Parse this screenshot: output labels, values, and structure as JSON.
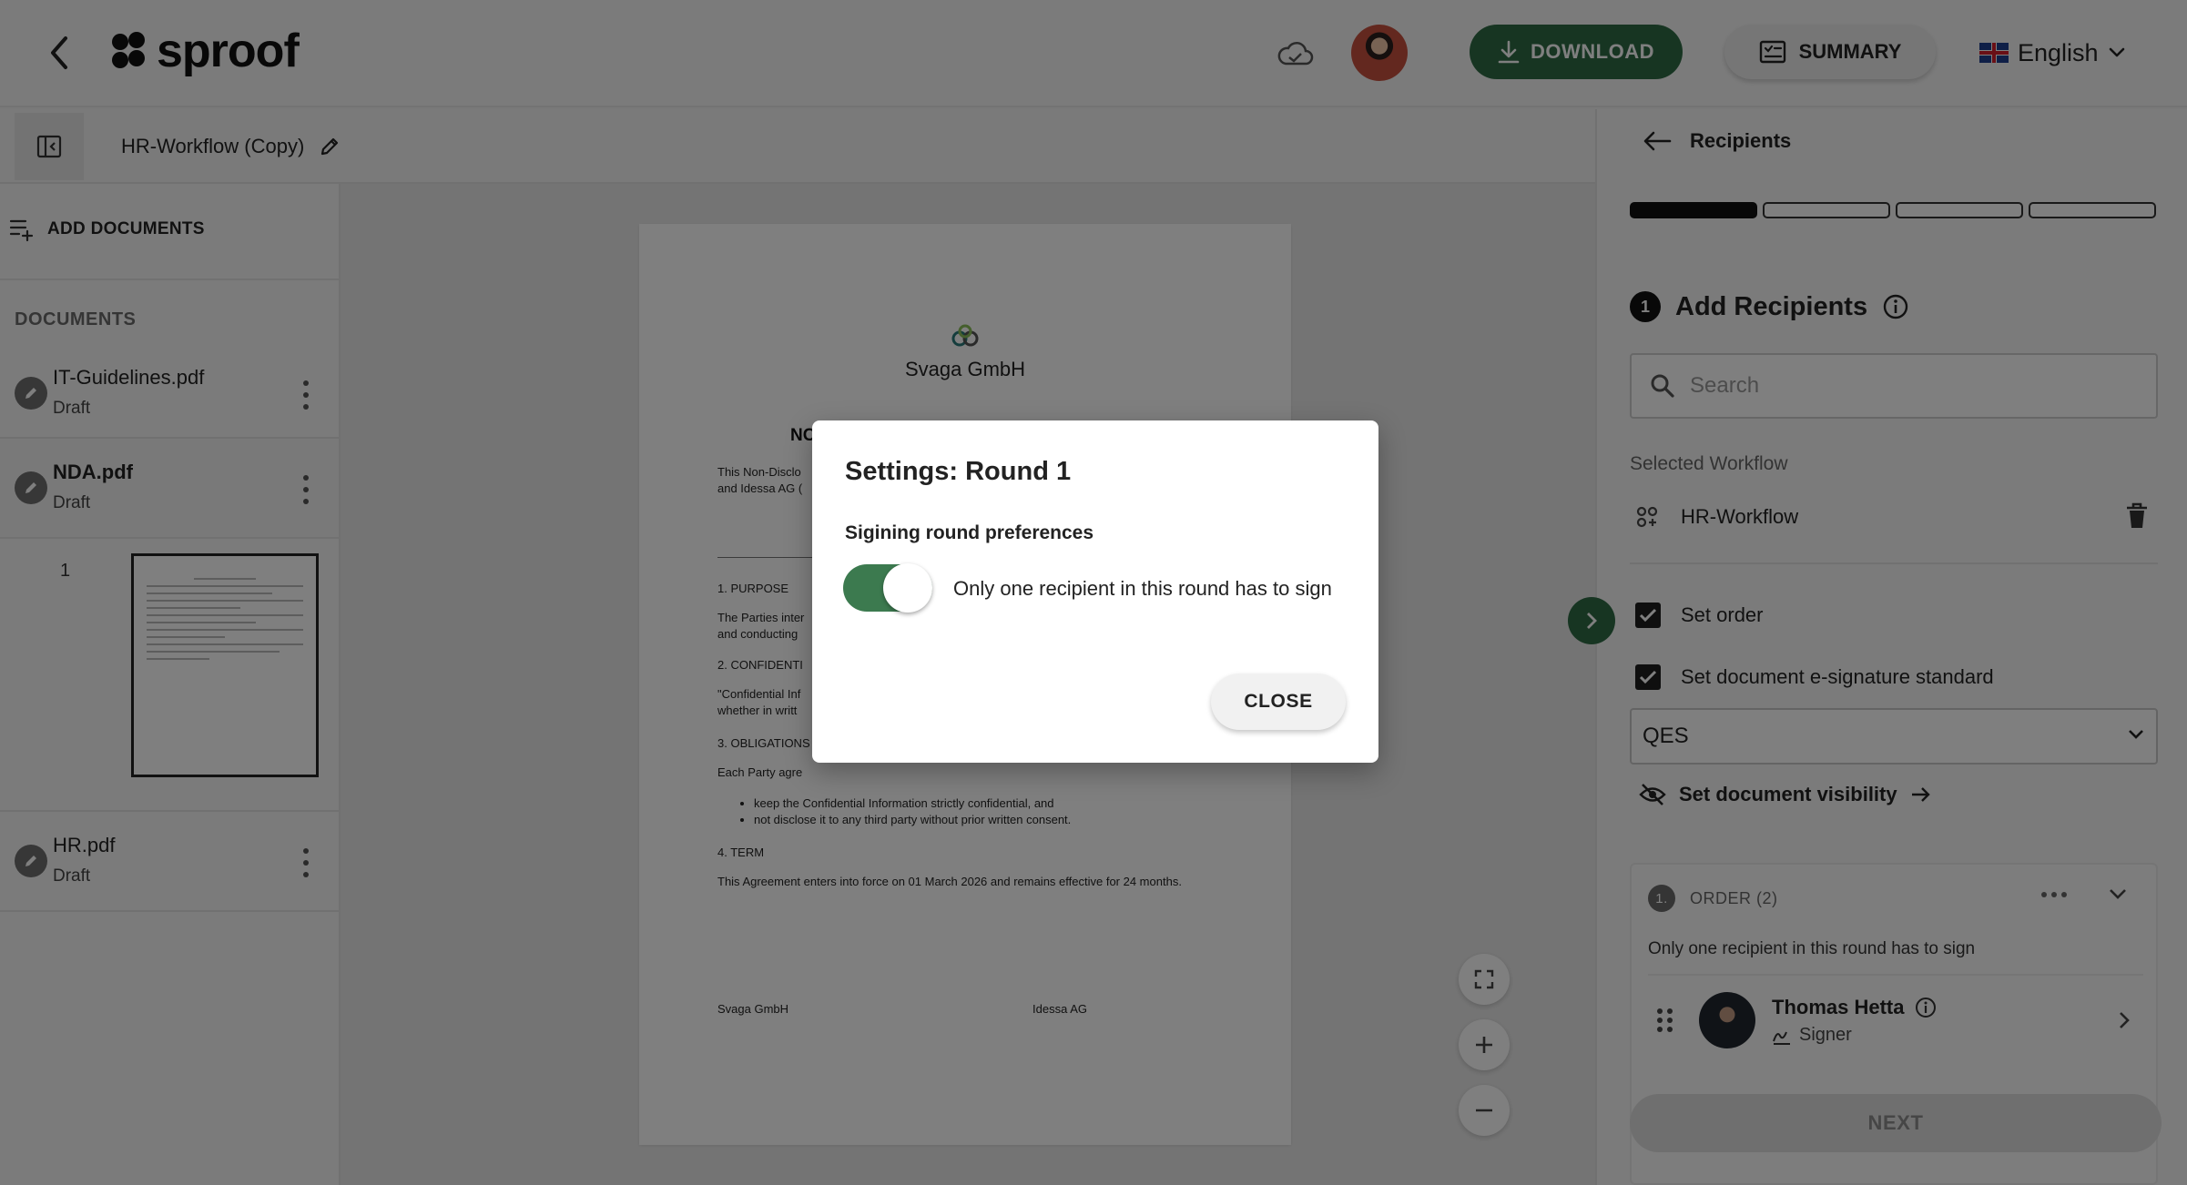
{
  "header": {
    "logo_text": "sproof",
    "download_label": "DOWNLOAD",
    "summary_label": "SUMMARY",
    "language": "English"
  },
  "subbar": {
    "document_title": "HR-Workflow (Copy)"
  },
  "sidebar": {
    "add_documents_label": "ADD DOCUMENTS",
    "documents_heading": "DOCUMENTS",
    "documents": [
      {
        "name": "IT-Guidelines.pdf",
        "status": "Draft"
      },
      {
        "name": "NDA.pdf",
        "status": "Draft"
      },
      {
        "name": "HR.pdf",
        "status": "Draft"
      }
    ],
    "page_thumbnail_number": "1"
  },
  "document": {
    "company": "Svaga GmbH",
    "heading_fragment": "NC",
    "intro_line1": "This Non-Disclo",
    "intro_line2": "and Idessa AG (",
    "section1": "1. PURPOSE",
    "section1_text1": "The Parties inter",
    "section1_text2": "and conducting",
    "section2": "2. CONFIDENTI",
    "section2_text1": "\"Confidential Inf",
    "section2_text2": "whether in writt",
    "section3": "3. OBLIGATIONS",
    "section3_text": "Each Party agre",
    "bullet1": "keep the Confidential Information strictly confidential, and",
    "bullet2": "not disclose it to any third party without prior written consent.",
    "section4": "4. TERM",
    "section4_text": "This Agreement enters into force on 01 March 2026 and remains effective for 24 months.",
    "sign_left": "Svaga GmbH",
    "sign_right": "Idessa AG"
  },
  "right_panel": {
    "back_label": "Recipients",
    "progress_steps_total": 4,
    "progress_steps_done": 1,
    "step_number": "1",
    "step_title": "Add Recipients",
    "search_placeholder": "Search",
    "selected_workflow_label": "Selected Workflow",
    "workflow_name": "HR-Workflow",
    "set_order_label": "Set order",
    "set_standard_label": "Set document e-signature standard",
    "standard_value": "QES",
    "visibility_label": "Set document visibility",
    "order": {
      "number": "1.",
      "label": "ORDER (2)",
      "note": "Only one recipient in this round has to sign",
      "recipient_name": "Thomas Hetta",
      "recipient_role": "Signer"
    },
    "next_label": "NEXT"
  },
  "modal": {
    "title": "Settings: Round 1",
    "subtitle": "Sigining round preferences",
    "toggle_label": "Only one recipient in this round has to sign",
    "toggle_on": true,
    "close_label": "CLOSE"
  },
  "colors": {
    "accent_green": "#2f6b45",
    "toggle_green": "#3c7a4f",
    "overlay": "rgba(0,0,0,0.5)"
  }
}
